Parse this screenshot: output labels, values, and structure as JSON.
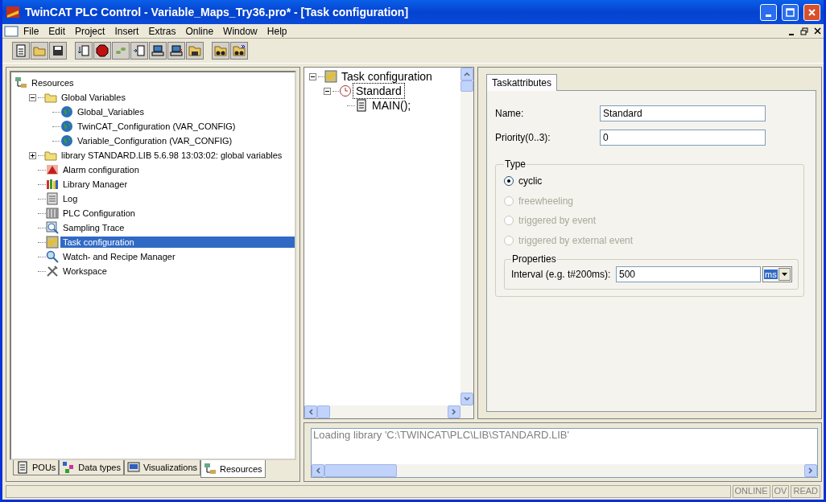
{
  "window": {
    "title": "TwinCAT PLC Control - Variable_Maps_Try36.pro* - [Task configuration]"
  },
  "menu": [
    "File",
    "Edit",
    "Project",
    "Insert",
    "Extras",
    "Online",
    "Window",
    "Help"
  ],
  "resources_tree": [
    {
      "label": "Resources",
      "kind": "resources",
      "selected": false,
      "children": [
        {
          "label": "Global Variables",
          "kind": "folder",
          "selected": false,
          "expanded": true,
          "children": [
            {
              "label": "Global_Variables",
              "kind": "globe",
              "selected": false
            },
            {
              "label": "TwinCAT_Configuration (VAR_CONFIG)",
              "kind": "globe",
              "selected": false
            },
            {
              "label": "Variable_Configuration (VAR_CONFIG)",
              "kind": "globe",
              "selected": false
            }
          ]
        },
        {
          "label": "library STANDARD.LIB 5.6.98 13:03:02: global variables",
          "kind": "folder",
          "selected": false,
          "expanded": false
        },
        {
          "label": "Alarm configuration",
          "kind": "alarm",
          "selected": false
        },
        {
          "label": "Library Manager",
          "kind": "books",
          "selected": false
        },
        {
          "label": "Log",
          "kind": "log",
          "selected": false
        },
        {
          "label": "PLC Configuration",
          "kind": "plc",
          "selected": false
        },
        {
          "label": "Sampling Trace",
          "kind": "trace",
          "selected": false
        },
        {
          "label": "Task configuration",
          "kind": "task",
          "selected": true
        },
        {
          "label": "Watch- and Recipe Manager",
          "kind": "watch",
          "selected": false
        },
        {
          "label": "Workspace",
          "kind": "tools",
          "selected": false
        }
      ]
    }
  ],
  "bottom_tabs": [
    {
      "label": "POUs",
      "kind": "pou",
      "selected": false
    },
    {
      "label": "Data types",
      "kind": "types",
      "selected": false
    },
    {
      "label": "Visualizations",
      "kind": "visu",
      "selected": false
    },
    {
      "label": "Resources",
      "kind": "resources",
      "selected": true
    }
  ],
  "task_tree": [
    {
      "label": "Task configuration",
      "kind": "task",
      "selected": false,
      "expanded": true,
      "children": [
        {
          "label": "Standard",
          "kind": "clock",
          "selected": true,
          "expanded": true,
          "children": [
            {
              "label": "MAIN();",
              "kind": "page",
              "selected": false
            }
          ]
        }
      ]
    }
  ],
  "editor": {
    "tab": "Taskattributes",
    "name": {
      "label": "Name:",
      "value": "Standard"
    },
    "priority": {
      "label": "Priority(0..3):",
      "value": "0"
    },
    "type": {
      "title": "Type",
      "options": [
        {
          "label": "cyclic",
          "selected": true,
          "disabled": false
        },
        {
          "label": "freewheeling",
          "selected": false,
          "disabled": true
        },
        {
          "label": "triggered by event",
          "selected": false,
          "disabled": true
        },
        {
          "label": "triggered by external event",
          "selected": false,
          "disabled": true
        }
      ]
    },
    "properties": {
      "title": "Properties",
      "interval_label": "Interval (e.g. t#200ms):",
      "interval": "500",
      "unit": "ms"
    }
  },
  "messages": [
    "Loading library 'C:\\TWINCAT\\PLC\\LIB\\STANDARD.LIB'"
  ],
  "status_bar": [
    "ONLINE",
    "OV",
    "READ"
  ]
}
